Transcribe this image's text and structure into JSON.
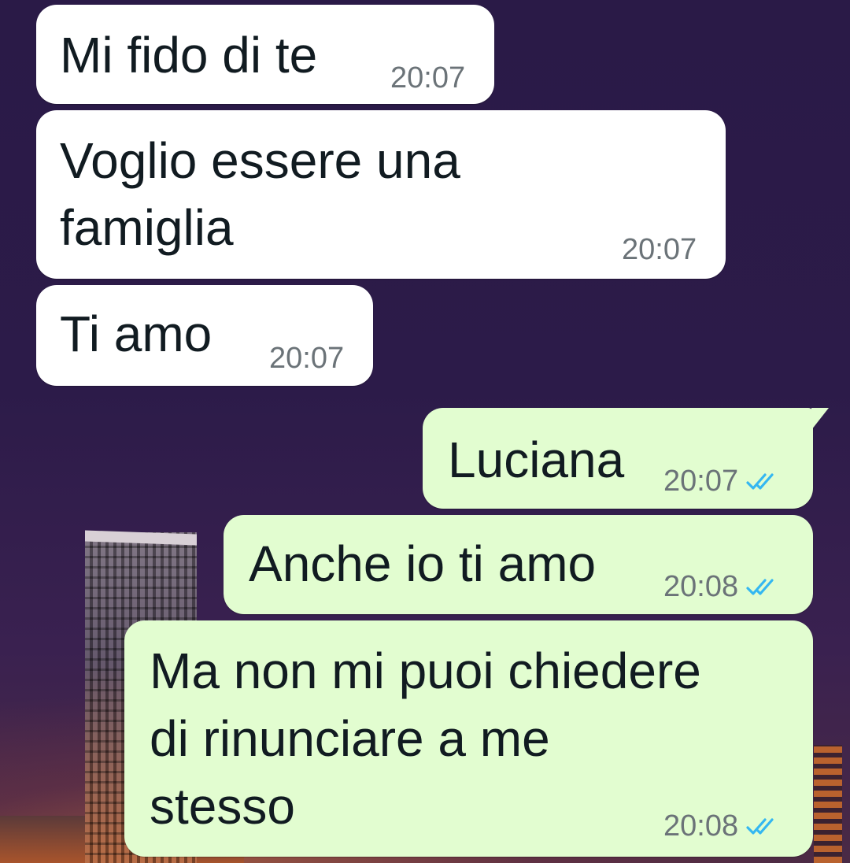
{
  "messages": [
    {
      "direction": "incoming",
      "text": "Mi fido di te",
      "time": "20:07"
    },
    {
      "direction": "incoming",
      "lines": [
        "Voglio essere una",
        "famiglia"
      ],
      "time": "20:07"
    },
    {
      "direction": "incoming",
      "text": "Ti amo",
      "time": "20:07"
    },
    {
      "direction": "outgoing",
      "text": "Luciana",
      "time": "20:07",
      "status": "read"
    },
    {
      "direction": "outgoing",
      "text": "Anche io ti amo",
      "time": "20:08",
      "status": "read"
    },
    {
      "direction": "outgoing",
      "lines": [
        "Ma non mi puoi chiedere",
        "di rinunciare a me",
        "stesso"
      ],
      "time": "20:08",
      "status": "read"
    }
  ],
  "colors": {
    "incoming_bubble": "#ffffff",
    "outgoing_bubble": "#e2fdd0",
    "read_ticks": "#34b7f1",
    "timestamp": "#6b7378"
  },
  "icons": {
    "read_status": "double-check-icon"
  }
}
